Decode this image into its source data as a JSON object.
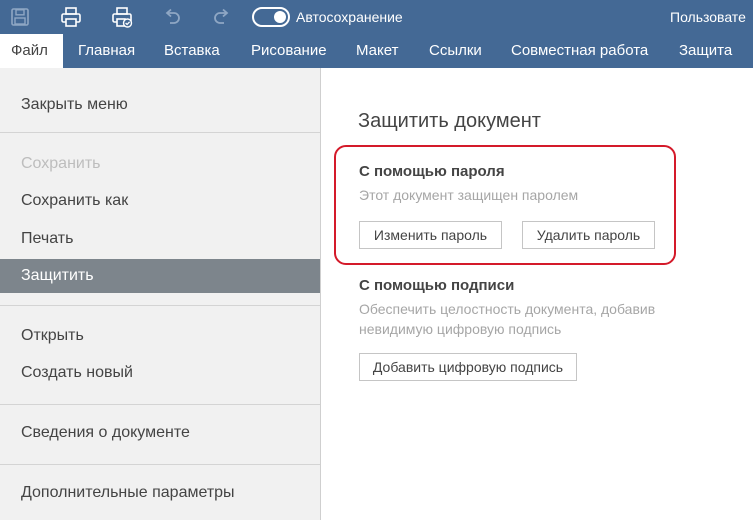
{
  "titlebar": {
    "icons": [
      "save-icon",
      "print-icon",
      "quick-print-icon",
      "undo-icon",
      "redo-icon"
    ],
    "autosave_label": "Автосохранение",
    "autosave_on": true,
    "user_label": "Пользовате"
  },
  "tabs": [
    "Файл",
    "Главная",
    "Вставка",
    "Рисование",
    "Макет",
    "Ссылки",
    "Совместная работа",
    "Защита"
  ],
  "sidebar": {
    "close_menu": "Закрыть меню",
    "save": "Сохранить",
    "save_as": "Сохранить как",
    "print": "Печать",
    "protect": "Защитить",
    "open": "Открыть",
    "create_new": "Создать новый",
    "document_info": "Сведения о документе",
    "advanced_settings": "Дополнительные параметры"
  },
  "main": {
    "title": "Защитить документ",
    "password_section": {
      "title": "С помощью пароля",
      "description": "Этот документ защищен паролем",
      "change_button": "Изменить пароль",
      "delete_button": "Удалить пароль"
    },
    "signature_section": {
      "title": "С помощью подписи",
      "description_line1": "Обеспечить целостность документа, добавив",
      "description_line2": "невидимую цифровую подпись",
      "add_button": "Добавить цифровую подпись"
    }
  },
  "colors": {
    "header": "#446995",
    "sidebar_bg": "#f1f1f1",
    "selected_item": "#7d858c",
    "highlight_border": "#d41a2a"
  }
}
